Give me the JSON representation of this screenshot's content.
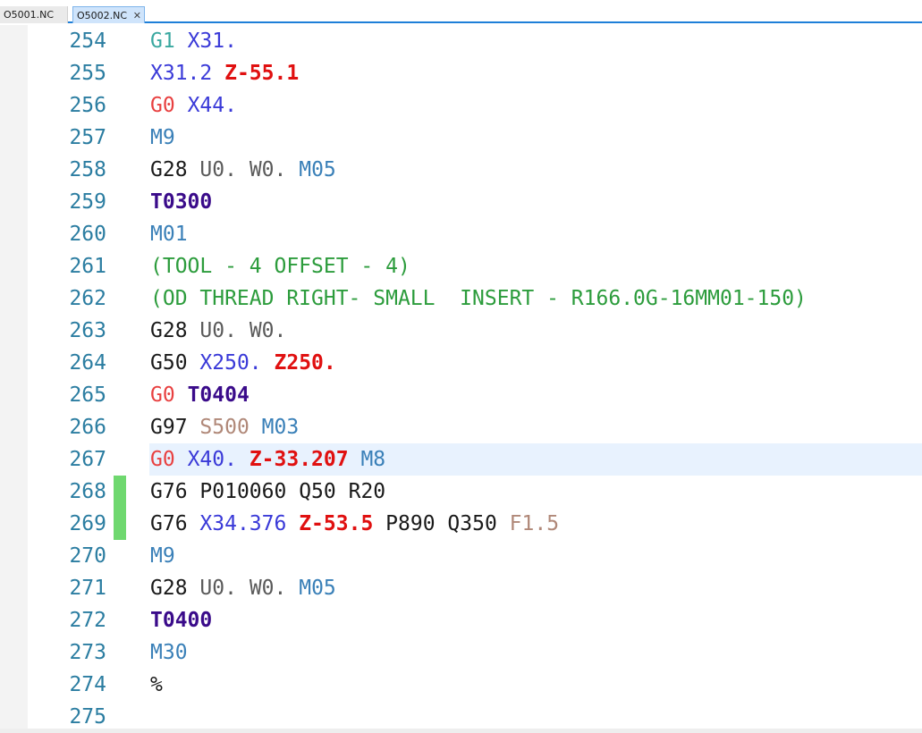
{
  "tabs": [
    {
      "label": "O5001.NC",
      "active": false
    },
    {
      "label": "O5002.NC",
      "active": true,
      "close": "✕"
    }
  ],
  "colors": {
    "accent": "#1e7fd8",
    "current_line_bg": "#e8f2fe",
    "change_marker": "#6fd86f",
    "line_number": "#2b7da1"
  },
  "editor": {
    "current_line": 267,
    "changed_lines": [
      268,
      269
    ],
    "lines": [
      {
        "n": "254",
        "tokens": [
          [
            "G1",
            "g"
          ],
          [
            " ",
            "d"
          ],
          [
            "X31.",
            "x"
          ]
        ]
      },
      {
        "n": "255",
        "tokens": [
          [
            "X31.2",
            "x"
          ],
          [
            " ",
            "d"
          ],
          [
            "Z-55.1",
            "z"
          ]
        ]
      },
      {
        "n": "256",
        "tokens": [
          [
            "G0",
            "g0"
          ],
          [
            " ",
            "d"
          ],
          [
            "X44.",
            "x"
          ]
        ]
      },
      {
        "n": "257",
        "tokens": [
          [
            "M9",
            "m"
          ]
        ]
      },
      {
        "n": "258",
        "tokens": [
          [
            "G28",
            "d"
          ],
          [
            " ",
            "d"
          ],
          [
            "U0.",
            "uw"
          ],
          [
            " ",
            "d"
          ],
          [
            "W0.",
            "uw"
          ],
          [
            " ",
            "d"
          ],
          [
            "M05",
            "m"
          ]
        ]
      },
      {
        "n": "259",
        "tokens": [
          [
            "T0300",
            "t"
          ]
        ]
      },
      {
        "n": "260",
        "tokens": [
          [
            "M01",
            "m"
          ]
        ]
      },
      {
        "n": "261",
        "tokens": [
          [
            "(TOOL - 4 OFFSET - 4)",
            "cm"
          ]
        ]
      },
      {
        "n": "262",
        "tokens": [
          [
            "(OD THREAD RIGHT- SMALL  INSERT - R166.0G-16MM01-150)",
            "cm"
          ]
        ]
      },
      {
        "n": "263",
        "tokens": [
          [
            "G28",
            "d"
          ],
          [
            " ",
            "d"
          ],
          [
            "U0.",
            "uw"
          ],
          [
            " ",
            "d"
          ],
          [
            "W0.",
            "uw"
          ]
        ]
      },
      {
        "n": "264",
        "tokens": [
          [
            "G50",
            "d"
          ],
          [
            " ",
            "d"
          ],
          [
            "X250.",
            "x"
          ],
          [
            " ",
            "d"
          ],
          [
            "Z250.",
            "z"
          ]
        ]
      },
      {
        "n": "265",
        "tokens": [
          [
            "G0",
            "g0"
          ],
          [
            " ",
            "d"
          ],
          [
            "T0404",
            "t"
          ]
        ]
      },
      {
        "n": "266",
        "tokens": [
          [
            "G97",
            "d"
          ],
          [
            " ",
            "d"
          ],
          [
            "S500",
            "s"
          ],
          [
            " ",
            "d"
          ],
          [
            "M03",
            "m"
          ]
        ]
      },
      {
        "n": "267",
        "tokens": [
          [
            "G0",
            "g0"
          ],
          [
            " ",
            "d"
          ],
          [
            "X40.",
            "x"
          ],
          [
            " ",
            "d"
          ],
          [
            "Z-33.207",
            "z"
          ],
          [
            " ",
            "d"
          ],
          [
            "M8",
            "m"
          ]
        ]
      },
      {
        "n": "268",
        "tokens": [
          [
            "G76",
            "d"
          ],
          [
            " ",
            "d"
          ],
          [
            "P010060",
            "p"
          ],
          [
            " ",
            "d"
          ],
          [
            "Q50",
            "p"
          ],
          [
            " ",
            "d"
          ],
          [
            "R20",
            "p"
          ]
        ]
      },
      {
        "n": "269",
        "tokens": [
          [
            "G76",
            "d"
          ],
          [
            " ",
            "d"
          ],
          [
            "X34.376",
            "x"
          ],
          [
            " ",
            "d"
          ],
          [
            "Z-53.5",
            "z"
          ],
          [
            " ",
            "d"
          ],
          [
            "P890",
            "p"
          ],
          [
            " ",
            "d"
          ],
          [
            "Q350",
            "p"
          ],
          [
            " ",
            "d"
          ],
          [
            "F1.5",
            "f"
          ]
        ]
      },
      {
        "n": "270",
        "tokens": [
          [
            "M9",
            "m"
          ]
        ]
      },
      {
        "n": "271",
        "tokens": [
          [
            "G28",
            "d"
          ],
          [
            " ",
            "d"
          ],
          [
            "U0.",
            "uw"
          ],
          [
            " ",
            "d"
          ],
          [
            "W0.",
            "uw"
          ],
          [
            " ",
            "d"
          ],
          [
            "M05",
            "m"
          ]
        ]
      },
      {
        "n": "272",
        "tokens": [
          [
            "T0400",
            "t"
          ]
        ]
      },
      {
        "n": "273",
        "tokens": [
          [
            "M30",
            "m"
          ]
        ]
      },
      {
        "n": "274",
        "tokens": [
          [
            "%",
            "d"
          ]
        ]
      },
      {
        "n": "275",
        "tokens": []
      }
    ]
  }
}
